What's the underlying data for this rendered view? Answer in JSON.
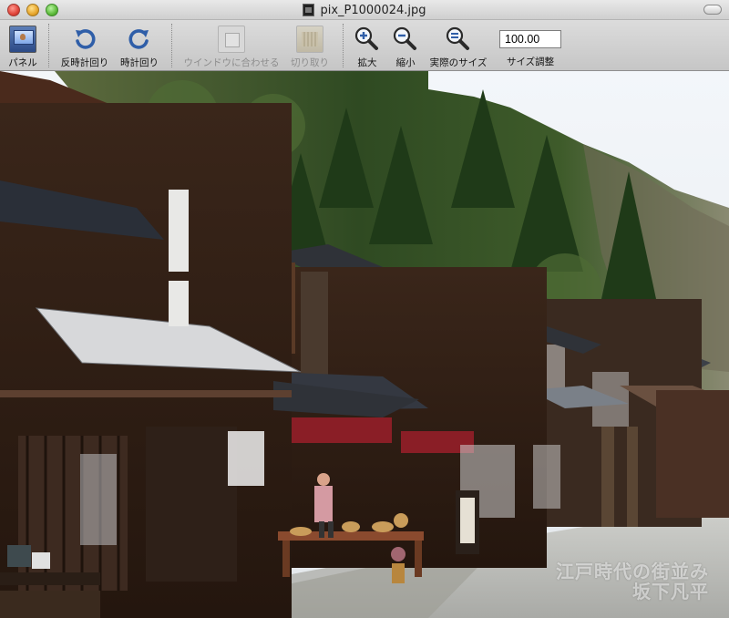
{
  "window": {
    "title": "pix_P1000024.jpg"
  },
  "toolbar": {
    "panel_label": "パネル",
    "rotate_ccw_label": "反時計回り",
    "rotate_cw_label": "時計回り",
    "fit_window_label": "ウインドウに合わせる",
    "crop_label": "切り取り",
    "zoom_in_label": "拡大",
    "zoom_out_label": "縮小",
    "actual_size_label": "実際のサイズ",
    "zoom_value": "100.00",
    "zoom_adjust_label": "サイズ調整"
  },
  "icons": {
    "panel": "panel-icon",
    "rotate_ccw": "rotate-left-icon",
    "rotate_cw": "rotate-right-icon",
    "fit_window": "fit-window-icon",
    "crop": "crop-icon",
    "zoom_in": "zoom-in-icon",
    "zoom_out": "zoom-out-icon",
    "actual_size": "actual-size-icon"
  },
  "photo": {
    "watermark_line1": "江戸時代の街並み",
    "watermark_line2": "坂下凡平"
  },
  "colors": {
    "accent_blue": "#2f5ea8",
    "disabled_text": "#8d8d8d"
  }
}
